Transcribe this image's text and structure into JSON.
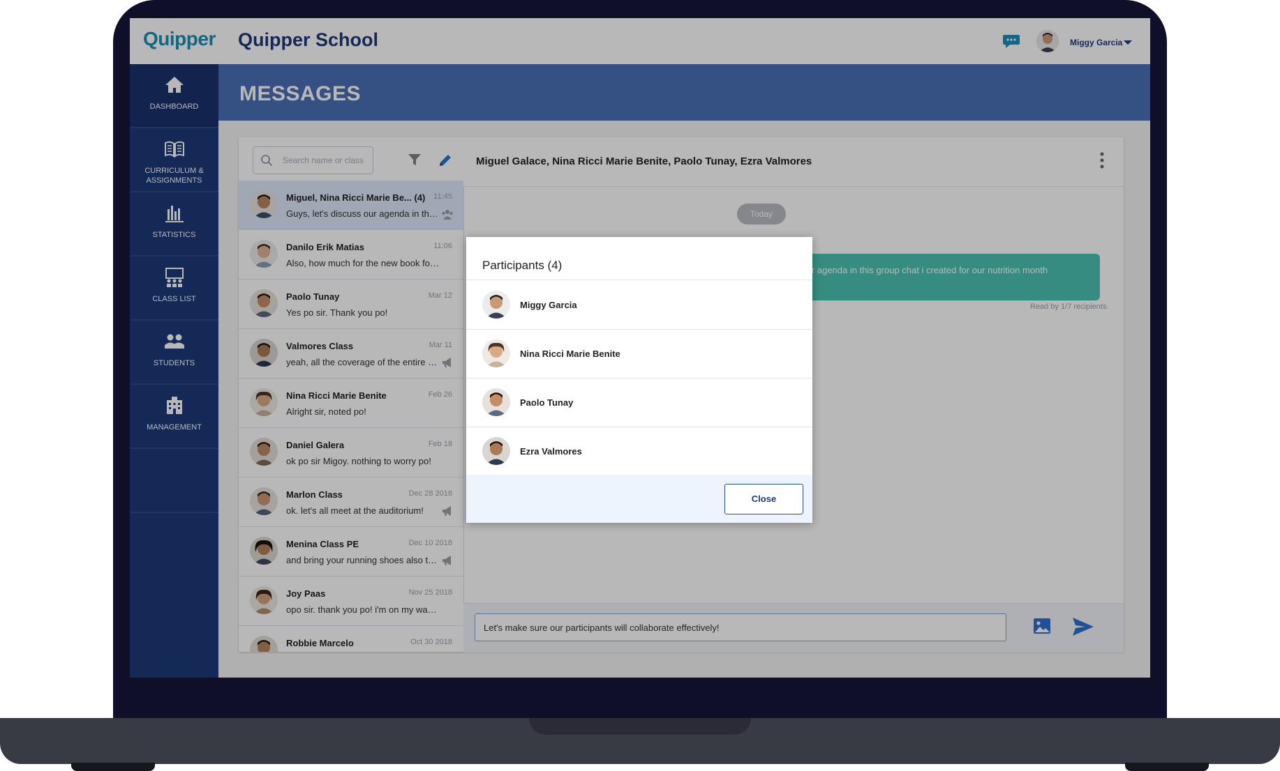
{
  "app": {
    "logo": "Quipper",
    "title": "Quipper School",
    "user_name": "Miggy Garcia"
  },
  "nav": [
    {
      "label": "DASHBOARD",
      "icon": "home-icon"
    },
    {
      "label": "CURRICULUM & ASSIGNMENTS",
      "icon": "book-icon"
    },
    {
      "label": "STATISTICS",
      "icon": "bar-chart-icon"
    },
    {
      "label": "CLASS LIST",
      "icon": "class-list-icon"
    },
    {
      "label": "STUDENTS",
      "icon": "students-icon"
    },
    {
      "label": "MANAGEMENT",
      "icon": "building-icon"
    }
  ],
  "page": {
    "title": "MESSAGES"
  },
  "search": {
    "placeholder": "Search name or class"
  },
  "conversations": [
    {
      "name": "Miguel, Nina Ricci Marie Be... (4)",
      "time": "11:45",
      "preview": "Guys, let's discuss our agenda in this ...",
      "active": true,
      "group": true
    },
    {
      "name": "Danilo Erik Matias",
      "time": "11:06",
      "preview": "Also, how much for the new book for ph..."
    },
    {
      "name": "Paolo Tunay",
      "time": "Mar 12",
      "preview": "Yes po sir. Thank you po!"
    },
    {
      "name": "Valmores Class",
      "time": "Mar 11",
      "preview": "yeah, all the coverage of the entire e...",
      "megaphone": true
    },
    {
      "name": "Nina Ricci Marie Benite",
      "time": "Feb 26",
      "preview": "Alright sir, noted po!"
    },
    {
      "name": "Daniel Galera",
      "time": "Feb 18",
      "preview": "ok po sir Migoy. nothing to worry po!"
    },
    {
      "name": "Marlon Class",
      "time": "Dec 28 2018",
      "preview": "ok. let's all meet at the auditorium!",
      "megaphone": true
    },
    {
      "name": "Menina Class PE",
      "time": "Dec 10 2018",
      "preview": "and bring your running shoes also to...",
      "megaphone": true
    },
    {
      "name": "Joy Paas",
      "time": "Nov 25 2018",
      "preview": "opo sir. thank you po! i'm on my way po."
    },
    {
      "name": "Robbie Marcelo",
      "time": "Oct 30 2018",
      "preview": ""
    }
  ],
  "chat": {
    "title": "Miguel Galace, Nina Ricci Marie Benite, Paolo Tunay, Ezra Valmores",
    "date_pill": "Today",
    "bubble_text": "dicuss our agenda in this group chat i created for our nutrition month\non.",
    "read_receipt": "Read by 1/7 recipients.",
    "compose_value": "Let's make sure our participants will collaborate effectively!"
  },
  "modal": {
    "title": "Participants (4)",
    "participants": [
      "Miggy Garcia",
      "Nina Ricci Marie Benite",
      "Paolo Tunay",
      "Ezra Valmores"
    ],
    "close_label": "Close"
  },
  "colors": {
    "brand": "#1e3a78",
    "header": "#4a71b8",
    "teal": "#4cc3b2",
    "logo": "#1a8fb5"
  }
}
